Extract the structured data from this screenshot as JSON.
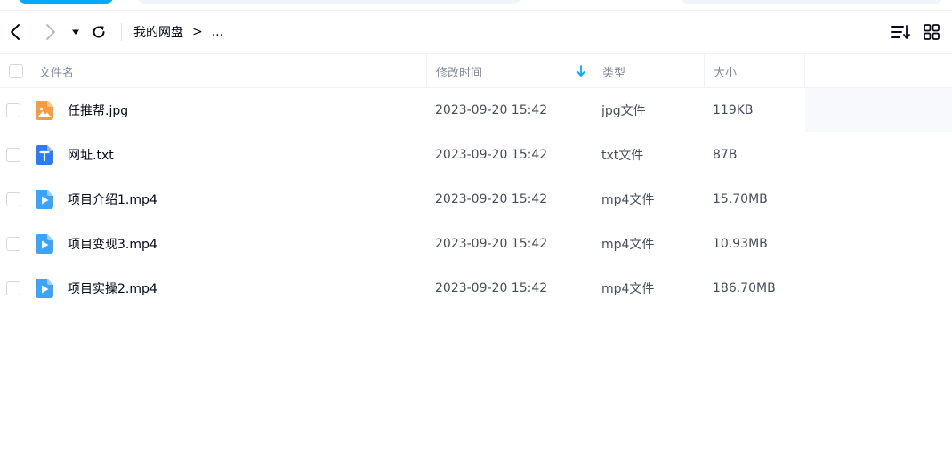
{
  "toolbar": {
    "breadcrumb": [
      "我的网盘",
      "..."
    ],
    "breadcrumb_separator": ">"
  },
  "table": {
    "headers": {
      "name": "文件名",
      "modified": "修改时间",
      "type": "类型",
      "size": "大小"
    },
    "sorted_by": "modified",
    "sort_direction": "descending",
    "rows": [
      {
        "name": "任推帮.jpg",
        "modified": "2023-09-20 15:42",
        "type": "jpg文件",
        "size": "119KB",
        "icon": "image-file-icon"
      },
      {
        "name": "网址.txt",
        "modified": "2023-09-20 15:42",
        "type": "txt文件",
        "size": "87B",
        "icon": "text-file-icon"
      },
      {
        "name": "项目介绍1.mp4",
        "modified": "2023-09-20 15:42",
        "type": "mp4文件",
        "size": "15.70MB",
        "icon": "video-file-icon"
      },
      {
        "name": "项目变现3.mp4",
        "modified": "2023-09-20 15:42",
        "type": "mp4文件",
        "size": "10.93MB",
        "icon": "video-file-icon"
      },
      {
        "name": "项目实操2.mp4",
        "modified": "2023-09-20 15:42",
        "type": "mp4文件",
        "size": "186.70MB",
        "icon": "video-file-icon"
      }
    ]
  },
  "colors": {
    "accent": "#06a7ff",
    "image_icon": "#ff9a3e",
    "text_icon": "#2b7bff",
    "video_icon": "#3aa5ff",
    "header_text": "#818999"
  }
}
